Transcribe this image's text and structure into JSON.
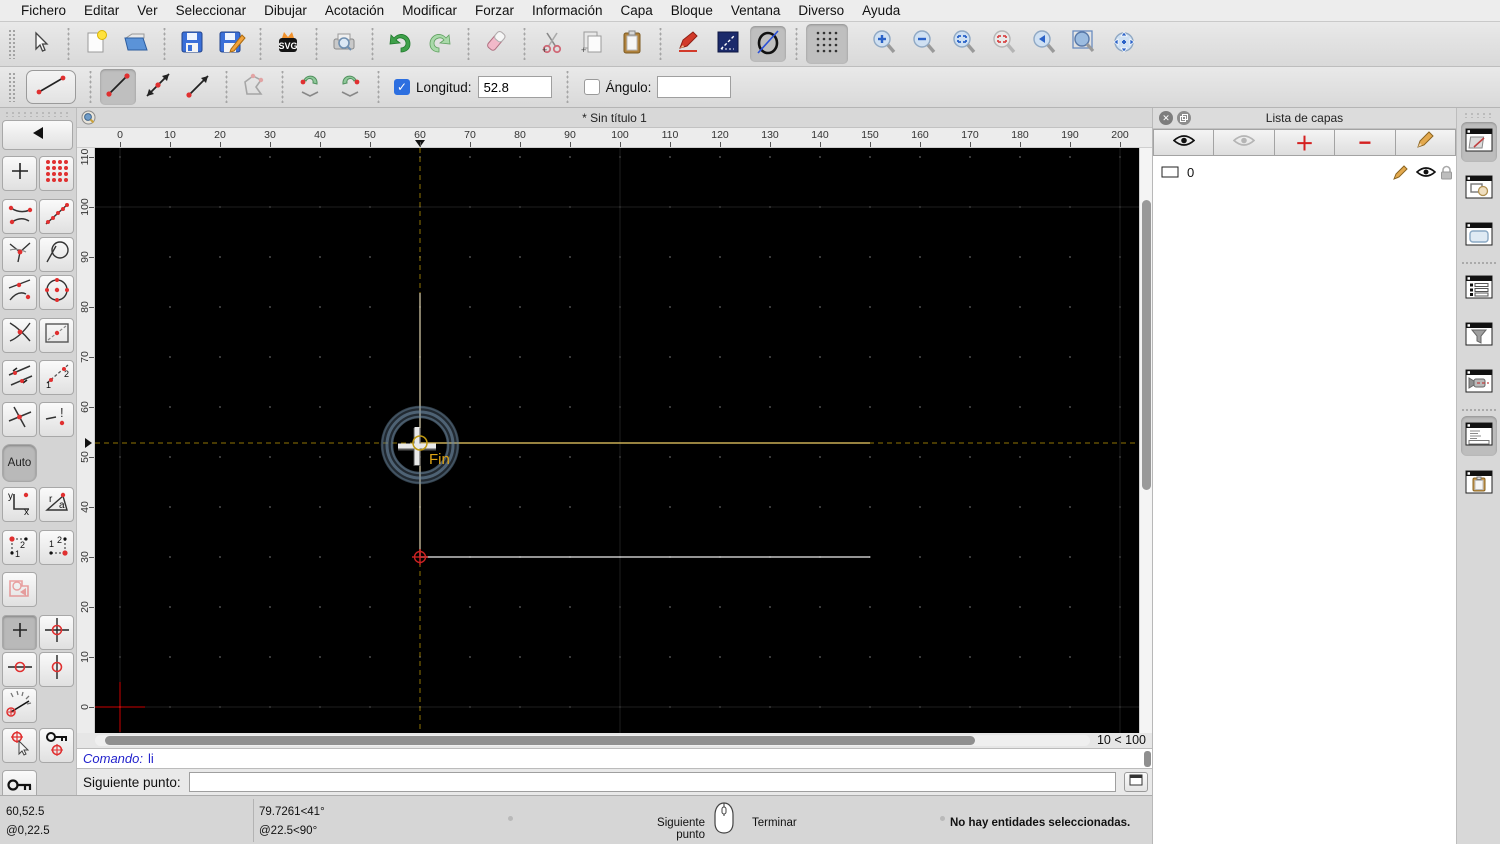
{
  "menu": {
    "items": [
      "Fichero",
      "Editar",
      "Ver",
      "Seleccionar",
      "Dibujar",
      "Acotación",
      "Modificar",
      "Forzar",
      "Información",
      "Capa",
      "Bloque",
      "Ventana",
      "Diverso",
      "Ayuda"
    ]
  },
  "toolbar_main": {
    "icons": [
      "select-cursor",
      "new-document",
      "open-file",
      "save",
      "save-as",
      "export-svg",
      "print-preview",
      "undo",
      "redo",
      "delete",
      "cut",
      "copy",
      "paste",
      "pen-edit",
      "line-properties",
      "draw-circle-slash",
      "grid-toggle",
      "zoom-in",
      "zoom-out",
      "zoom-auto",
      "zoom-redraw",
      "zoom-previous",
      "zoom-window",
      "zoom-pan"
    ]
  },
  "tool_options": {
    "current_tool": "line-two-points",
    "mode_icons": [
      "line-segment",
      "line-both-arrows",
      "line-arrow"
    ],
    "length_label": "Longitud:",
    "length_value": "52.8",
    "length_checked": true,
    "angle_label": "Ángulo:",
    "angle_value": "",
    "angle_checked": false
  },
  "snap_palette": {
    "auto_label": "Auto",
    "icons": [
      "back",
      "snap-free",
      "snap-grid",
      "snap-endpoints",
      "snap-on-entity",
      "snap-middle",
      "snap-tangent",
      "snap-nearest",
      "snap-center",
      "snap-intersection",
      "restrict-box",
      "snap-parallel",
      "snap-distance",
      "intersection-x",
      "intersection-manual",
      "auto",
      "coord-cartesian",
      "coord-polar",
      "corner-ordered-12",
      "corner-ordered-21",
      "action-stamp",
      "restrict-nothing",
      "restrict-orthogonal",
      "restrict-horizontal",
      "restrict-vertical",
      "set-relative-angle",
      "set-relative-zero",
      "lock-relative-zero",
      "key-lock"
    ]
  },
  "document": {
    "title": "* Sin título 1",
    "grid_indicator": "10 < 100",
    "snap_indicator": "Fin"
  },
  "rulers": {
    "horizontal": [
      "0",
      "10",
      "20",
      "30",
      "40",
      "50",
      "60",
      "70",
      "80",
      "90",
      "100",
      "110",
      "120",
      "130",
      "140",
      "150",
      "160",
      "170",
      "180",
      "190",
      "200"
    ],
    "vertical": [
      "0",
      "10",
      "20",
      "30",
      "40",
      "50",
      "60",
      "70",
      "80",
      "90",
      "100",
      "110"
    ]
  },
  "command_area": {
    "history_label": "Comando:",
    "history_value": "li",
    "prompt_label": "Siguiente punto:",
    "input_value": ""
  },
  "status_bar": {
    "coord_abs": "60,52.5",
    "coord_rel": "@0,22.5",
    "polar_abs": "79.7261<41°",
    "polar_rel": "@22.5<90°",
    "mouse_left": "Siguiente punto",
    "mouse_right": "Terminar",
    "selection_status": "No hay entidades seleccionadas."
  },
  "layer_panel": {
    "title": "Lista de capas",
    "toolbar_icons": [
      "show-all-layers",
      "hide-all-layers",
      "add-layer",
      "remove-layer",
      "edit-layer"
    ],
    "layers": [
      {
        "name": "0",
        "visible": true,
        "locked": false
      }
    ]
  },
  "dock": {
    "icons": [
      "layer-list-window",
      "block-list-window",
      "library-browser-window",
      "entity-list-window",
      "filter-window",
      "pen-wizard-window",
      "command-widget-window",
      "clipboard-window"
    ]
  },
  "colors": {
    "canvas_bg": "#000000",
    "crosshair": "#8f7405",
    "entity_gray": "#c6c6c6",
    "entity_gold": "#c9ae55",
    "snap_circle": "#6d89a1",
    "snap_text": "#dfa414",
    "relative_zero": "#cc2222",
    "accent_blue": "#2d6fe0",
    "origin_cross": "#cc0000"
  }
}
